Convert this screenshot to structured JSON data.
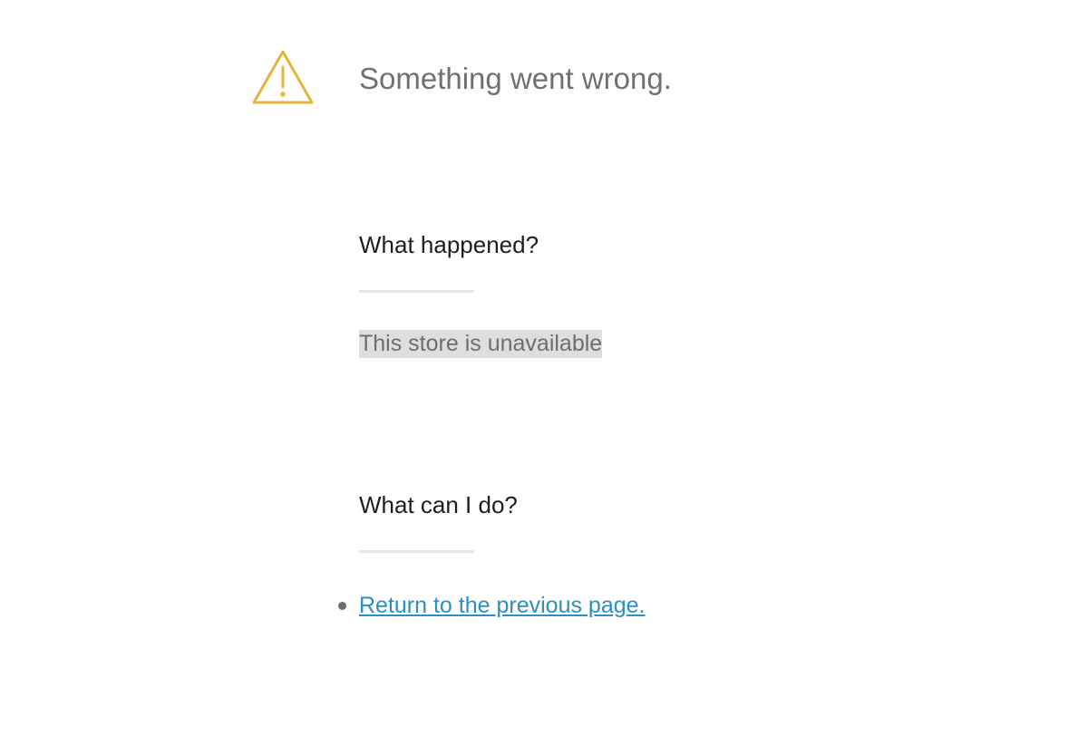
{
  "header": {
    "icon": "warning-icon",
    "icon_color": "#e8b33a",
    "title": "Something went wrong."
  },
  "what_happened": {
    "heading": "What happened?",
    "message": "This store is unavailable"
  },
  "what_can_i_do": {
    "heading": "What can I do?",
    "actions": [
      {
        "label": "Return to the previous page."
      }
    ]
  },
  "colors": {
    "link": "#2a8fc4",
    "heading": "#1e1e1e",
    "muted_text": "#707070",
    "divider": "#e6e6e6"
  }
}
